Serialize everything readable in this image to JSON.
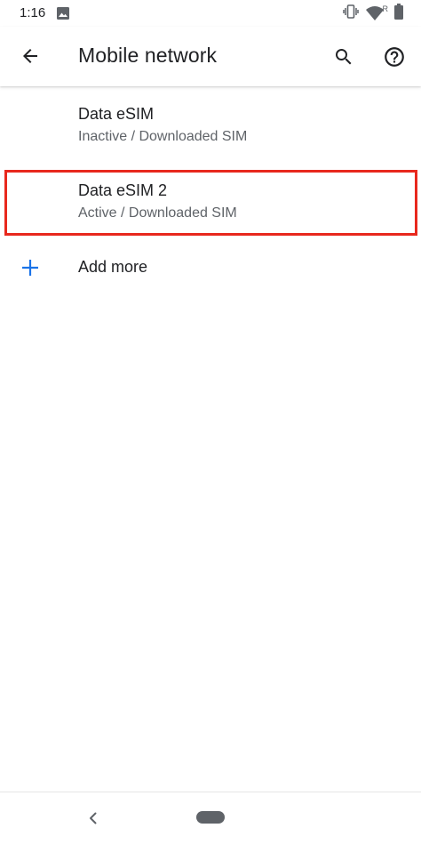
{
  "status_bar": {
    "time": "1:16",
    "left_icons": [
      "gallery-icon"
    ],
    "right_icons": [
      "vibrate-icon",
      "wifi-icon",
      "roaming-indicator-icon",
      "battery-icon"
    ],
    "roaming_letter": "R"
  },
  "app_bar": {
    "title": "Mobile network",
    "back_icon": "arrow-back-icon",
    "search_icon": "search-icon",
    "help_icon": "help-icon"
  },
  "sims": [
    {
      "title": "Data eSIM",
      "summary": "Inactive / Downloaded SIM",
      "highlighted": false
    },
    {
      "title": "Data eSIM 2",
      "summary": "Active / Downloaded SIM",
      "highlighted": true
    }
  ],
  "add_more": {
    "label": "Add more",
    "icon": "plus-icon"
  },
  "colors": {
    "accent": "#1a73e8",
    "highlight": "#e8281d",
    "text_primary": "#202124",
    "text_secondary": "#5f6368"
  },
  "nav_bar": {
    "back_icon": "nav-back-icon",
    "home_pill": "home-pill"
  }
}
